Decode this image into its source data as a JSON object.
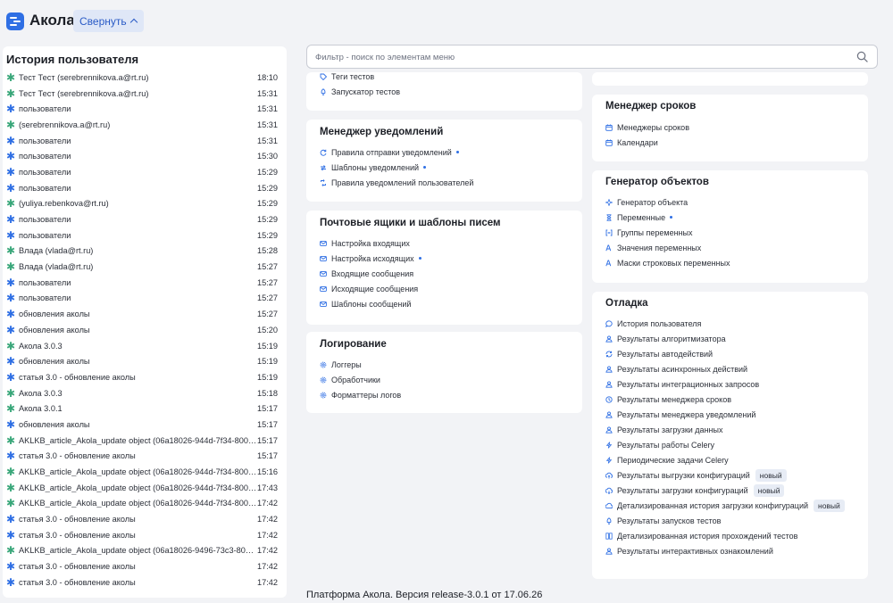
{
  "header": {
    "app_title": "Акола",
    "collapse_label": "Свернуть"
  },
  "history": {
    "title": "История пользователя",
    "rows": [
      {
        "text": "Тест Тест (serebrennikova.a@rt.ru)",
        "time": "18:10",
        "color": "green"
      },
      {
        "text": "Тест Тест (serebrennikova.a@rt.ru)",
        "time": "15:31",
        "color": "green"
      },
      {
        "text": "пользователи",
        "time": "15:31",
        "color": "blue"
      },
      {
        "text": "(serebrennikova.a@rt.ru)",
        "time": "15:31",
        "color": "green"
      },
      {
        "text": "пользователи",
        "time": "15:31",
        "color": "blue"
      },
      {
        "text": "пользователи",
        "time": "15:30",
        "color": "blue"
      },
      {
        "text": "пользователи",
        "time": "15:29",
        "color": "blue"
      },
      {
        "text": "пользователи",
        "time": "15:29",
        "color": "blue"
      },
      {
        "text": "(yuliya.rebenkova@rt.ru)",
        "time": "15:29",
        "color": "green"
      },
      {
        "text": "пользователи",
        "time": "15:29",
        "color": "blue"
      },
      {
        "text": "пользователи",
        "time": "15:29",
        "color": "blue"
      },
      {
        "text": "Влада (vlada@rt.ru)",
        "time": "15:28",
        "color": "green"
      },
      {
        "text": "Влада (vlada@rt.ru)",
        "time": "15:27",
        "color": "green"
      },
      {
        "text": "пользователи",
        "time": "15:27",
        "color": "blue"
      },
      {
        "text": "пользователи",
        "time": "15:27",
        "color": "blue"
      },
      {
        "text": "обновления аколы",
        "time": "15:27",
        "color": "blue"
      },
      {
        "text": "обновления аколы",
        "time": "15:20",
        "color": "blue"
      },
      {
        "text": "Акола 3.0.3",
        "time": "15:19",
        "color": "green"
      },
      {
        "text": "обновления аколы",
        "time": "15:19",
        "color": "blue"
      },
      {
        "text": "статья 3.0 - обновление аколы",
        "time": "15:19",
        "color": "blue"
      },
      {
        "text": "Акола 3.0.3",
        "time": "15:18",
        "color": "green"
      },
      {
        "text": "Акола 3.0.1",
        "time": "15:17",
        "color": "green"
      },
      {
        "text": "обновления аколы",
        "time": "15:17",
        "color": "blue"
      },
      {
        "text": "AKLKB_article_Akola_update object (06a18026-944d-7f34-8000-9...",
        "time": "15:17",
        "color": "green"
      },
      {
        "text": "статья 3.0 - обновление аколы",
        "time": "15:17",
        "color": "blue"
      },
      {
        "text": "AKLKB_article_Akola_update object (06a18026-944d-7f34-8000-9...",
        "time": "15:16",
        "color": "green"
      },
      {
        "text": "AKLKB_article_Akola_update object (06a18026-944d-7f34-8000-9...",
        "time": "17:43",
        "color": "green"
      },
      {
        "text": "AKLKB_article_Akola_update object (06a18026-944d-7f34-8000-9...",
        "time": "17:42",
        "color": "green"
      },
      {
        "text": "статья 3.0 - обновление аколы",
        "time": "17:42",
        "color": "blue"
      },
      {
        "text": "статья 3.0 - обновление аколы",
        "time": "17:42",
        "color": "blue"
      },
      {
        "text": "AKLKB_article_Akola_update object (06a18026-9496-73c3-8000-0...",
        "time": "17:42",
        "color": "green"
      },
      {
        "text": "статья 3.0 - обновление аколы",
        "time": "17:42",
        "color": "blue"
      },
      {
        "text": "статья 3.0 - обновление аколы",
        "time": "17:42",
        "color": "blue"
      }
    ]
  },
  "search": {
    "placeholder": "Фильтр - поиск по элементам меню"
  },
  "cards": {
    "tests": {
      "items": [
        {
          "label": "Теги тестов",
          "icon": "tag-icon"
        },
        {
          "label": "Запускатор тестов",
          "icon": "rocket-icon"
        }
      ]
    },
    "notifications": {
      "title": "Менеджер уведомлений",
      "items": [
        {
          "label": "Правила отправки уведомлений",
          "icon": "refresh-icon",
          "dot": true
        },
        {
          "label": "Шаблоны уведомлений",
          "icon": "arrows-icon",
          "dot": true
        },
        {
          "label": "Правила уведомлений пользователей",
          "icon": "loop-icon"
        }
      ]
    },
    "mail": {
      "title": "Почтовые ящики и шаблоны писем",
      "items": [
        {
          "label": "Настройка входящих",
          "icon": "mail-icon"
        },
        {
          "label": "Настройка исходящих",
          "icon": "mail-icon",
          "dot": true
        },
        {
          "label": "Входящие сообщения",
          "icon": "mail-icon"
        },
        {
          "label": "Исходящие сообщения",
          "icon": "mail-icon"
        },
        {
          "label": "Шаблоны сообщений",
          "icon": "mail-icon"
        }
      ]
    },
    "logging": {
      "title": "Логирование",
      "items": [
        {
          "label": "Логгеры",
          "icon": "gear-icon"
        },
        {
          "label": "Обработчики",
          "icon": "gear-icon"
        },
        {
          "label": "Форматтеры логов",
          "icon": "gear-icon"
        }
      ]
    },
    "deadlines": {
      "title": "Менеджер сроков",
      "items": [
        {
          "label": "Менеджеры сроков",
          "icon": "calendar-icon"
        },
        {
          "label": "Календари",
          "icon": "calendar-icon"
        }
      ]
    },
    "generator": {
      "title": "Генератор объектов",
      "items": [
        {
          "label": "Генератор объекта",
          "icon": "sparkle-icon"
        },
        {
          "label": "Переменные",
          "icon": "hourglass-icon",
          "dot": true
        },
        {
          "label": "Группы переменных",
          "icon": "brackets-icon"
        },
        {
          "label": "Значения переменных",
          "icon": "text-icon"
        },
        {
          "label": "Маски строковых переменных",
          "icon": "text-icon"
        }
      ]
    },
    "debug": {
      "title": "Отладка",
      "items": [
        {
          "label": "История пользователя",
          "icon": "chat-icon"
        },
        {
          "label": "Результаты алгоритмизатора",
          "icon": "users-icon"
        },
        {
          "label": "Результаты автодействий",
          "icon": "cycle-icon"
        },
        {
          "label": "Результаты асинхронных действий",
          "icon": "users-icon"
        },
        {
          "label": "Результаты интеграционных запросов",
          "icon": "users-icon"
        },
        {
          "label": "Результаты менеджера сроков",
          "icon": "clock-icon"
        },
        {
          "label": "Результаты менеджера уведомлений",
          "icon": "users-icon"
        },
        {
          "label": "Результаты загрузки данных",
          "icon": "users-icon"
        },
        {
          "label": "Результаты работы Celery",
          "icon": "leaf-icon"
        },
        {
          "label": "Периодические задачи Celery",
          "icon": "leaf-icon"
        },
        {
          "label": "Результаты выгрузки конфигураций",
          "icon": "cloud-upload-icon",
          "badge": "новый"
        },
        {
          "label": "Результаты загрузки конфигураций",
          "icon": "cloud-download-icon",
          "badge": "новый"
        },
        {
          "label": "Детализированная история загрузки конфигураций",
          "icon": "cloud-icon",
          "badge": "новый"
        },
        {
          "label": "Результаты запусков тестов",
          "icon": "rocket-icon"
        },
        {
          "label": "Детализированная история прохождений тестов",
          "icon": "grid-icon"
        },
        {
          "label": "Результаты интерактивных ознакомлений",
          "icon": "users-icon"
        }
      ]
    }
  },
  "footer": {
    "text": "Платформа Акола. Версия release-3.0.1 от 17.06.26"
  },
  "colors": {
    "accent": "#2f6fe4",
    "green_marker": "#3aa77a",
    "collapse_bg": "#dfe7f7"
  }
}
